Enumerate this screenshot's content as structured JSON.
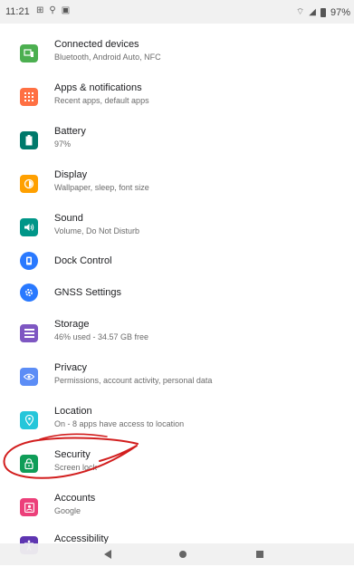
{
  "status_bar": {
    "time": "11:21",
    "battery": "97%"
  },
  "settings": {
    "items": [
      {
        "title": "Connected devices",
        "subtitle": "Bluetooth, Android Auto, NFC",
        "icon": "connected-devices-icon",
        "color": "#4caf50"
      },
      {
        "title": "Apps & notifications",
        "subtitle": "Recent apps, default apps",
        "icon": "apps-grid-icon",
        "color": "#ff7043"
      },
      {
        "title": "Battery",
        "subtitle": "97%",
        "icon": "battery-icon",
        "color": "#00796b"
      },
      {
        "title": "Display",
        "subtitle": "Wallpaper, sleep, font size",
        "icon": "brightness-icon",
        "color": "#ffa000"
      },
      {
        "title": "Sound",
        "subtitle": "Volume, Do Not Disturb",
        "icon": "volume-icon",
        "color": "#009688"
      },
      {
        "title": "Dock Control",
        "subtitle": "",
        "icon": "dock-icon",
        "color": "#2979ff"
      },
      {
        "title": "GNSS Settings",
        "subtitle": "",
        "icon": "gear-icon",
        "color": "#2979ff"
      },
      {
        "title": "Storage",
        "subtitle": "46% used - 34.57 GB free",
        "icon": "storage-icon",
        "color": "#7e57c2"
      },
      {
        "title": "Privacy",
        "subtitle": "Permissions, account activity, personal data",
        "icon": "privacy-eye-icon",
        "color": "#5c8df6"
      },
      {
        "title": "Location",
        "subtitle": "On - 8 apps have access to location",
        "icon": "location-pin-icon",
        "color": "#26c6da"
      },
      {
        "title": "Security",
        "subtitle": "Screen lock",
        "icon": "lock-icon",
        "color": "#0f9d58"
      },
      {
        "title": "Accounts",
        "subtitle": "Google",
        "icon": "account-icon",
        "color": "#ec407a"
      },
      {
        "title": "Accessibility",
        "subtitle": "",
        "icon": "accessibility-icon",
        "color": "#5e35b1"
      }
    ]
  }
}
